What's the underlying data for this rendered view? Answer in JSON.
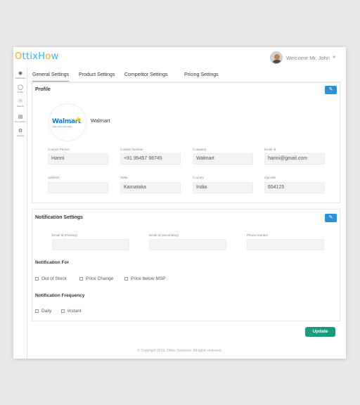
{
  "header": {
    "logo_text": [
      "O",
      "ttixH",
      "o",
      "w"
    ],
    "welcome": "Welcome Mr. John",
    "chevron_icon": "chevron-down-icon"
  },
  "sidebar": {
    "items": [
      {
        "icon": "dashboard-icon",
        "label": "Dashboard"
      },
      {
        "icon": "profile-icon",
        "label": "Profile"
      },
      {
        "icon": "mind-icon",
        "label": "Mind-P"
      },
      {
        "icon": "promotions-icon",
        "label": "Promotions"
      },
      {
        "icon": "settings-icon",
        "label": "Settings"
      }
    ]
  },
  "tabs": [
    "General Settings",
    "Product Settings",
    "Competitor Settings",
    "Pricing Settings"
  ],
  "profile": {
    "title": "Profile",
    "company_display": "Walmart",
    "logo_word": "Walmart",
    "logo_tagline": "Save money. Live better.",
    "fields": [
      {
        "label": "Contact Person",
        "value": "Harini"
      },
      {
        "label": "Contact Number",
        "value": "+91 95457 98745"
      },
      {
        "label": "Company",
        "value": "Walmart"
      },
      {
        "label": "Email Id",
        "value": "harini@gmail.com"
      },
      {
        "label": "Address",
        "value": ""
      },
      {
        "label": "State",
        "value": "Karnataka"
      },
      {
        "label": "Country",
        "value": "India"
      },
      {
        "label": "Zipcode",
        "value": "654125"
      }
    ]
  },
  "notification": {
    "title": "Notification Settings",
    "fields": [
      {
        "label": "Email Id (Primary)",
        "value": ""
      },
      {
        "label": "Email Id (Secondary)",
        "value": ""
      },
      {
        "label": "Phone Number",
        "value": ""
      }
    ],
    "for_title": "Notification For",
    "for_options": [
      "Out of Stock",
      "Price Change",
      "Price below MSP"
    ],
    "frequency_title": "Notification Frequency",
    "frequency_options": [
      "Daily",
      "Instant"
    ]
  },
  "actions": {
    "update": "Update"
  },
  "footer": "© Copyright 2019. Ottixo Solutions. All rights reserved.",
  "colors": {
    "accent": "#39b3e5",
    "edit_button": "#2d8fd6",
    "update_button": "#179c7c"
  }
}
